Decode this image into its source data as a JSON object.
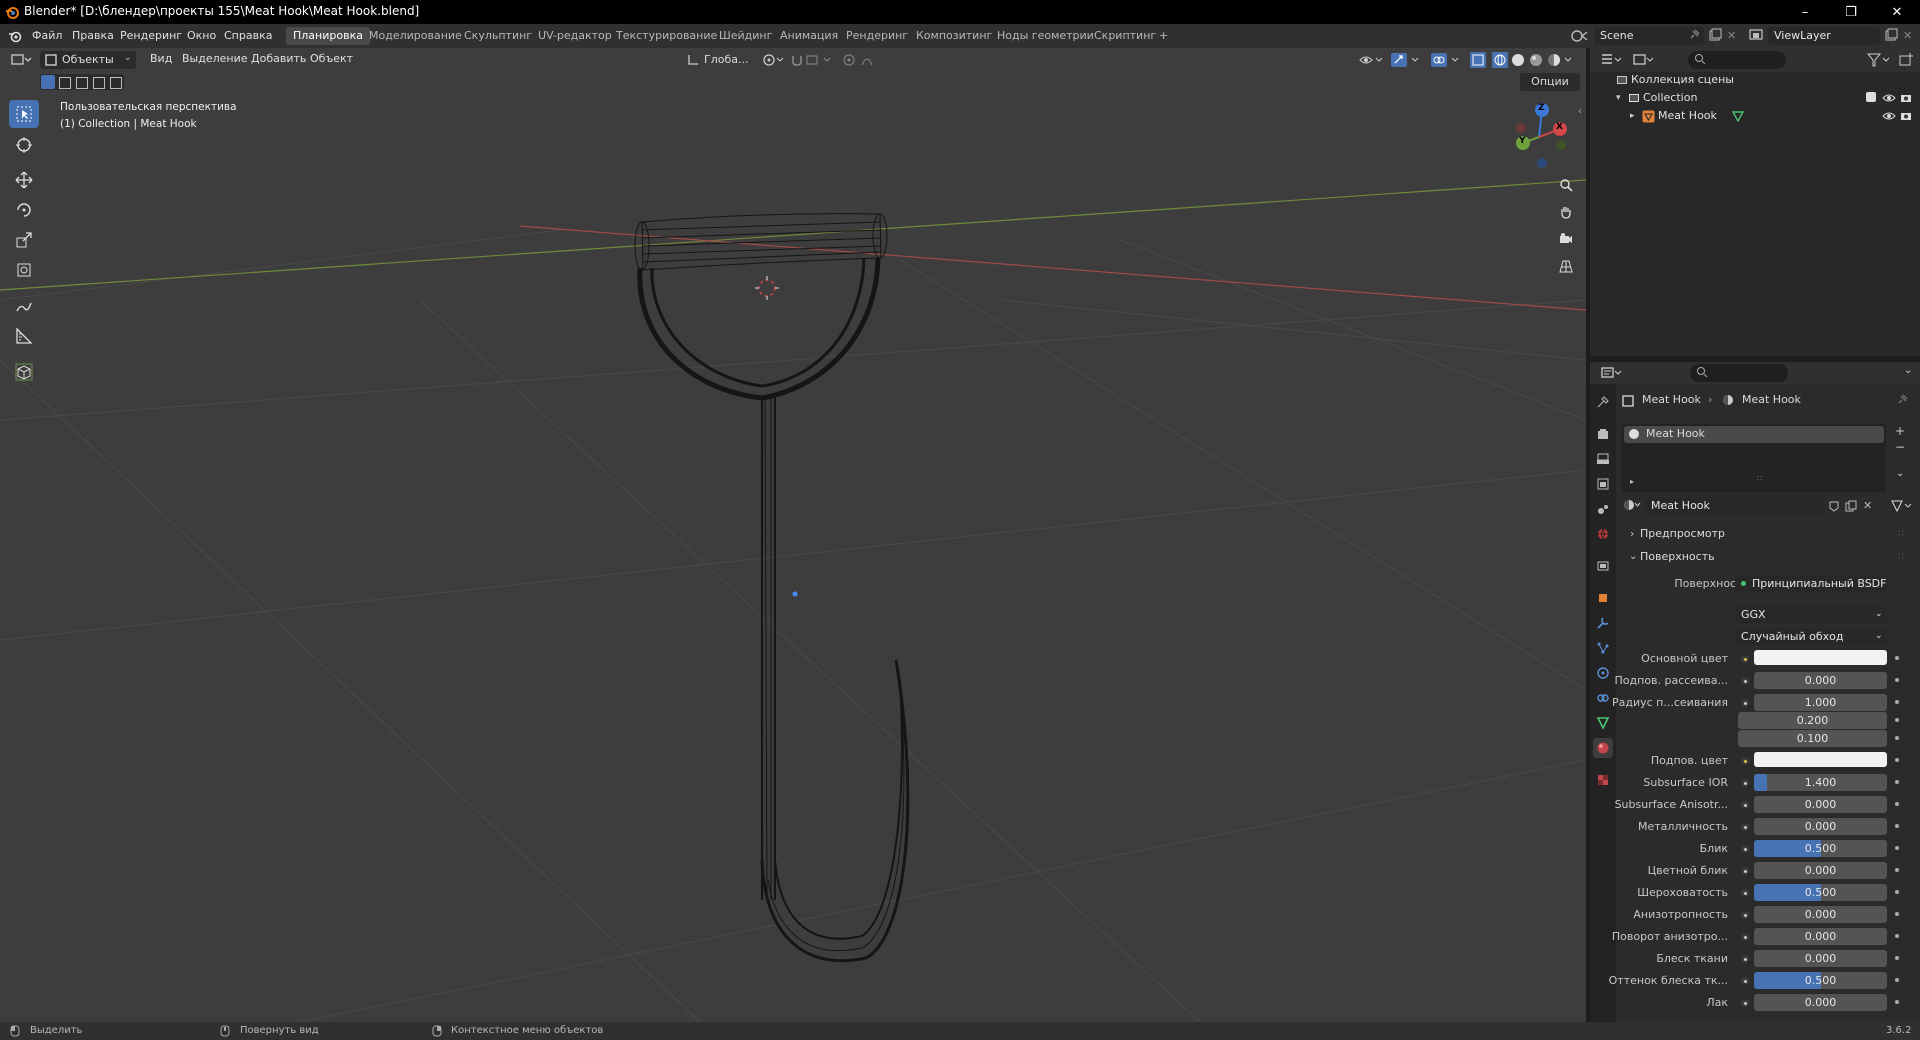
{
  "window": {
    "title": "Blender* [D:\\блендер\\проекты 155\\Meat Hook\\Meat Hook.blend]",
    "controls": {
      "minimize": "–",
      "restore": "❐",
      "close": "✕"
    }
  },
  "topbar": {
    "menus": [
      "Файл",
      "Правка",
      "Рендеринг",
      "Окно",
      "Справка"
    ],
    "workspaces": [
      "Планировка",
      "Моделирование",
      "Скульптинг",
      "UV-редактор",
      "Текстурирование",
      "Шейдинг",
      "Анимация",
      "Рендеринг",
      "Композитинг",
      "Ноды геометрии",
      "Скриптинг"
    ],
    "active_workspace": "Планировка",
    "add_tab": "+",
    "scene": "Scene",
    "view_layer": "ViewLayer"
  },
  "viewport": {
    "mode": "Объекты",
    "menus": [
      "Вид",
      "Выделение",
      "Добавить",
      "Объект"
    ],
    "transform_orientation": "Глоба...",
    "options_label": "Опции",
    "overlay_title": "Пользовательская перспектива",
    "overlay_subtitle": "(1) Collection | Meat Hook",
    "gizmo_labels": {
      "x": "X",
      "y": "Y",
      "z": "Z"
    },
    "colors": {
      "background": "#3d3d3d",
      "x_axis": "#a34a4a",
      "y_axis": "#6e8a3a",
      "wire": "#151515",
      "active_tool": "#4772b3"
    }
  },
  "outliner": {
    "scene_collection": "Коллекция сцены",
    "collection": "Collection",
    "object": "Meat Hook"
  },
  "properties": {
    "breadcrumb_object": "Meat Hook",
    "breadcrumb_material": "Meat Hook",
    "slot_name": "Meat Hook",
    "material_name": "Meat Hook",
    "panel_preview": "Предпросмотр",
    "panel_surface": "Поверхность",
    "surface_label": "Поверхность",
    "surface_value": "Принципиальный BSDF",
    "distribution": "GGX",
    "subsurface_method": "Случайный обход",
    "rows": [
      {
        "label": "Основной цвет",
        "type": "color",
        "value": "#f2f2f2"
      },
      {
        "label": "Подпов. рассеива...",
        "value": "0.000",
        "fill": 0
      },
      {
        "label": "Радиус п...сеивания",
        "value": "1.000",
        "fill": 0
      },
      {
        "label": "",
        "value": "0.200",
        "fill": 0
      },
      {
        "label": "",
        "value": "0.100",
        "fill": 0
      },
      {
        "label": "Подпов. цвет",
        "type": "color",
        "value": "#f2f2f2"
      },
      {
        "label": "Subsurface IOR",
        "value": "1.400",
        "fill": 0.1
      },
      {
        "label": "Subsurface Anisotr...",
        "value": "0.000",
        "fill": 0
      },
      {
        "label": "Металличность",
        "value": "0.000",
        "fill": 0
      },
      {
        "label": "Блик",
        "value": "0.500",
        "fill": 0.5
      },
      {
        "label": "Цветной блик",
        "value": "0.000",
        "fill": 0
      },
      {
        "label": "Шероховатость",
        "value": "0.500",
        "fill": 0.5
      },
      {
        "label": "Анизотропность",
        "value": "0.000",
        "fill": 0
      },
      {
        "label": "Поворот анизотро...",
        "value": "0.000",
        "fill": 0
      },
      {
        "label": "Блеск ткани",
        "value": "0.000",
        "fill": 0
      },
      {
        "label": "Оттенок блеска тк...",
        "value": "0.500",
        "fill": 0.5
      },
      {
        "label": "Лак",
        "value": "0.000",
        "fill": 0
      }
    ]
  },
  "statusbar": {
    "select": "Выделить",
    "rotate": "Повернуть вид",
    "context": "Контекстное меню объектов",
    "version": "3.6.2"
  }
}
